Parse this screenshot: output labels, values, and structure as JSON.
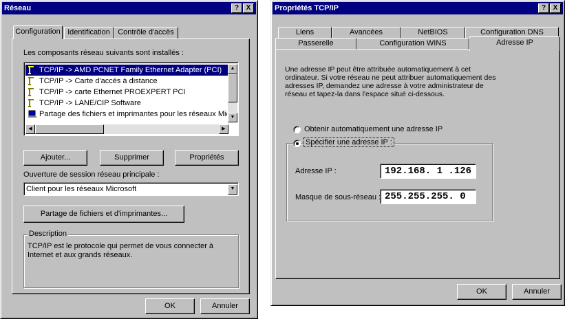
{
  "reseau": {
    "title": "Réseau",
    "title_buttons": {
      "help": "?",
      "close": "X"
    },
    "tabs": [
      "Configuration",
      "Identification",
      "Contrôle d'accès"
    ],
    "installed_label": "Les composants réseau suivants sont installés :",
    "components": [
      "TCP/IP -> AMD PCNET Family Ethernet Adapter (PCI)",
      "TCP/IP -> Carte d'accès à distance",
      "TCP/IP -> carte Ethernet PROEXPERT PCI",
      "TCP/IP -> LANE/CIP Software",
      "Partage des fichiers et imprimantes pour les réseaux Microsoft"
    ],
    "buttons": {
      "add": "Ajouter...",
      "remove": "Supprimer",
      "properties": "Propriétés"
    },
    "logon_label": "Ouverture de session réseau principale :",
    "logon_value": "Client pour les réseaux Microsoft",
    "sharing_button": "Partage de fichiers et d'imprimantes...",
    "description_legend": "Description",
    "description_text": "TCP/IP est le protocole qui permet de vous connecter à Internet et aux grands réseaux.",
    "ok": "OK",
    "cancel": "Annuler"
  },
  "tcpip": {
    "title": "Propriétés TCP/IP",
    "title_buttons": {
      "help": "?",
      "close": "X"
    },
    "tabs_back": [
      "Liens",
      "Avancées",
      "NetBIOS",
      "Configuration DNS"
    ],
    "tabs_front": [
      "Passerelle",
      "Configuration WINS",
      "Adresse IP"
    ],
    "intro": "Une adresse IP peut être attribuée automatiquement à cet ordinateur. Si votre réseau ne peut attribuer automatiquement des adresses IP, demandez une adresse à votre administrateur de réseau et tapez-la dans l'espace situé ci-dessous.",
    "radio_auto": "Obtenir automatiquement une adresse IP",
    "radio_manual": "Spécifier une adresse IP :",
    "ip_label": "Adresse IP :",
    "ip_value": "192.168. 1 .126",
    "mask_label": "Masque de sous-réseau :",
    "mask_value": "255.255.255. 0",
    "ok": "OK",
    "cancel": "Annuler"
  }
}
